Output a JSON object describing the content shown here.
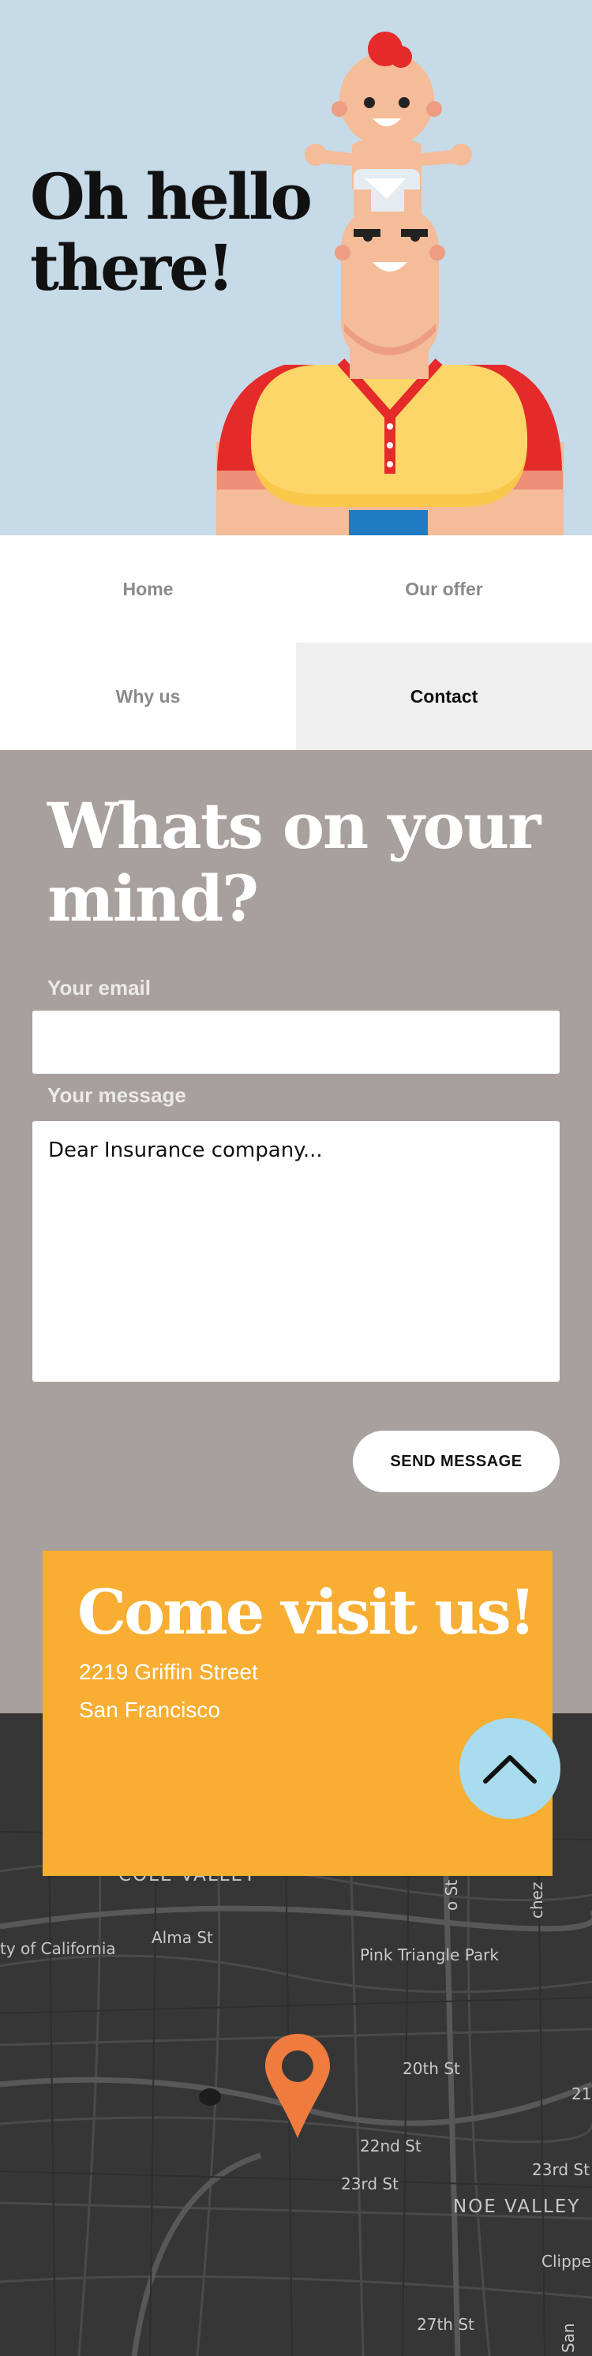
{
  "hero": {
    "title": "Oh hello there!"
  },
  "nav": {
    "items": [
      {
        "label": "Home",
        "active": false
      },
      {
        "label": "Our offer",
        "active": false
      },
      {
        "label": "Why us",
        "active": false
      },
      {
        "label": "Contact",
        "active": true
      }
    ]
  },
  "contact": {
    "title": "Whats on your mind?",
    "email_label": "Your email",
    "email_value": "",
    "message_label": "Your message",
    "message_value": "Dear Insurance company...",
    "send_label": "SEND MESSAGE"
  },
  "visit": {
    "title": "Come visit us!",
    "address_line1": "2219  Griffin Street",
    "address_line2": "San Francisco"
  },
  "map": {
    "labels": [
      {
        "text": "COLE VALLEY",
        "key": "cole"
      },
      {
        "text": "ty of California",
        "key": "univ"
      },
      {
        "text": "Alma St",
        "key": "alma"
      },
      {
        "text": "Pink Triangle Park",
        "key": "pink"
      },
      {
        "text": "20th St",
        "key": "st20"
      },
      {
        "text": "22nd St",
        "key": "st22"
      },
      {
        "text": "23rd St",
        "key": "st23a"
      },
      {
        "text": "23rd St",
        "key": "st23b"
      },
      {
        "text": "21",
        "key": "st21"
      },
      {
        "text": "NOE VALLEY",
        "key": "noe"
      },
      {
        "text": "Clippe",
        "key": "clip"
      },
      {
        "text": "27th St",
        "key": "st27"
      },
      {
        "text": "chez St",
        "key": "chez"
      },
      {
        "text": "o St",
        "key": "ost"
      },
      {
        "text": "San",
        "key": "san"
      }
    ]
  },
  "colors": {
    "hero_bg": "#c6dae8",
    "contact_bg": "#a7a09d",
    "visit_bg": "#f7ae32",
    "map_bg": "#363636",
    "pin": "#f07b3f",
    "scroll_button": "#a9dcee"
  },
  "icons": {
    "scroll_top": "chevron-up-icon",
    "map_pin": "map-pin-icon"
  }
}
